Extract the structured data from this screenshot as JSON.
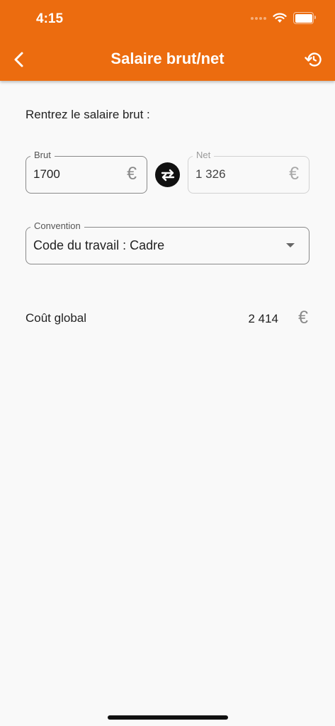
{
  "status_bar": {
    "time": "4:15"
  },
  "header": {
    "title": "Salaire brut/net"
  },
  "prompt": "Rentrez le salaire brut :",
  "gross_field": {
    "label": "Brut",
    "value": "1700",
    "currency": "€"
  },
  "net_field": {
    "label": "Net",
    "value": "1 326",
    "currency": "€"
  },
  "convention": {
    "label": "Convention",
    "selected": "Code du travail : Cadre"
  },
  "total_cost": {
    "label": "Coût global",
    "value": "2 414",
    "currency": "€"
  },
  "colors": {
    "accent": "#ec6c0f",
    "background": "#f9f9f9"
  },
  "icons": {
    "back": "chevron-left-icon",
    "reset": "history-icon",
    "swap": "swap-arrows-icon"
  }
}
